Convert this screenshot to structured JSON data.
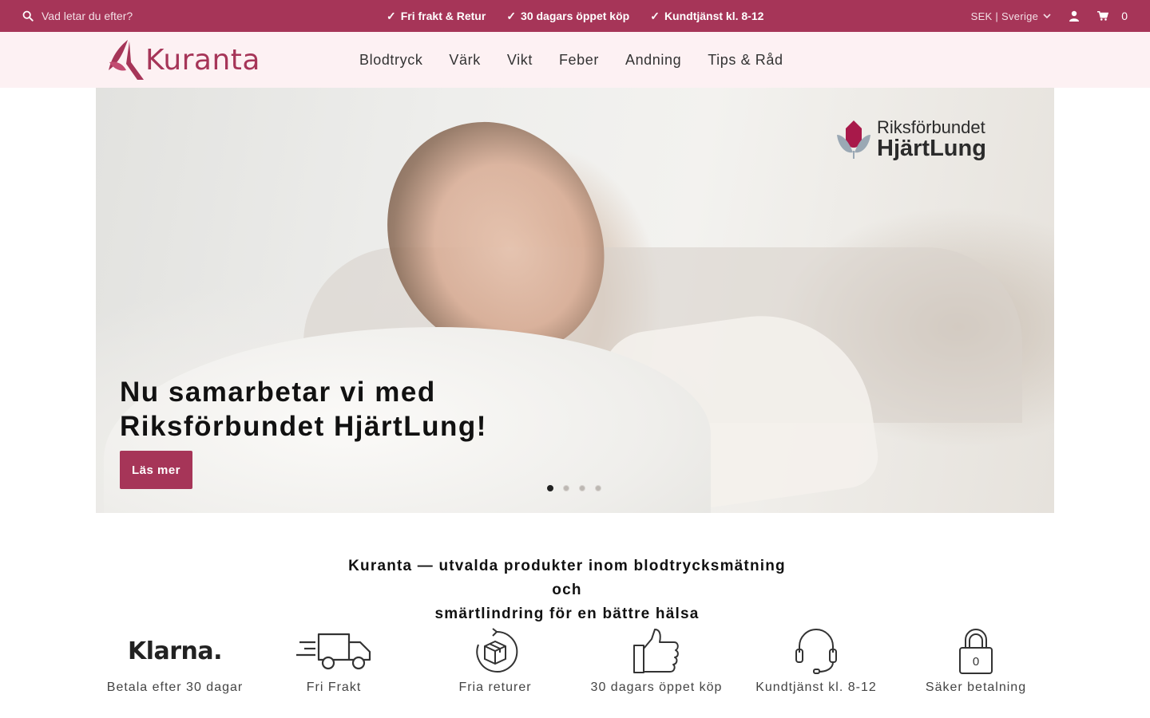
{
  "topbar": {
    "search_placeholder": "Vad letar du efter?",
    "usps": [
      "Fri frakt & Retur",
      "30 dagars öppet köp",
      "Kundtjänst kl. 8-12"
    ],
    "check_glyph": "✓",
    "locale": "SEK | Sverige",
    "cart_count": "0",
    "icons": [
      "search-icon",
      "checkmark-icon",
      "chevron-down-icon",
      "user-icon",
      "cart-icon"
    ]
  },
  "header": {
    "logo_text": "Kuranta",
    "nav": [
      "Blodtryck",
      "Värk",
      "Vikt",
      "Feber",
      "Andning",
      "Tips & Råd"
    ]
  },
  "hero": {
    "partner_line1": "Riksförbundet",
    "partner_line2": "HjärtLung",
    "headline_line1": "Nu samarbetar vi med",
    "headline_line2": "Riksförbundet HjärtLung!",
    "cta": "Läs mer",
    "slides_total": 4,
    "active_slide": 1
  },
  "tagline": {
    "line1": "Kuranta — utvalda produkter inom blodtrycksmätning och",
    "line2": "smärtlindring för en bättre hälsa"
  },
  "features": [
    {
      "icon": "klarna-logo",
      "logo_text": "Klarna.",
      "label": "Betala efter 30 dagar"
    },
    {
      "icon": "truck-icon",
      "label": "Fri Frakt"
    },
    {
      "icon": "return-box-icon",
      "label": "Fria returer"
    },
    {
      "icon": "thumbs-up-icon",
      "label": "30 dagars öppet köp"
    },
    {
      "icon": "headset-icon",
      "label": "Kundtjänst kl. 8-12"
    },
    {
      "icon": "padlock-icon",
      "lock_text": "0",
      "label": "Säker betalning"
    }
  ],
  "colors": {
    "brand": "#a63558",
    "header_bg": "#fdf1f3",
    "text": "#222222"
  }
}
